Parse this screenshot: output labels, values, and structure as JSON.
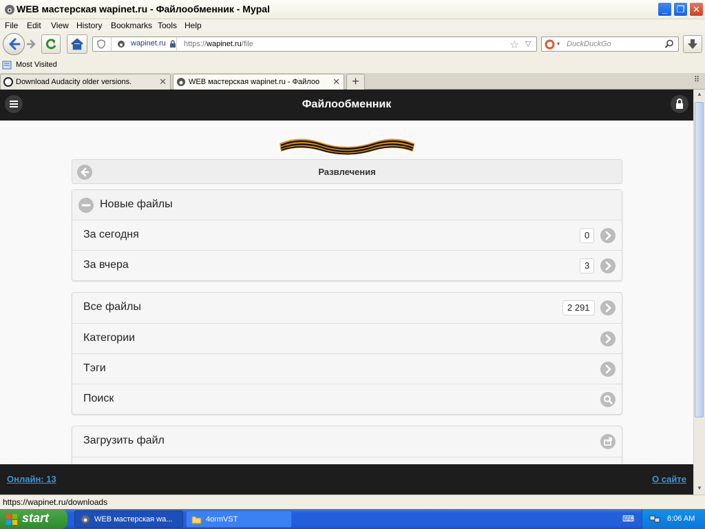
{
  "window": {
    "title": "WEB мастерская wapinet.ru - Файлообменник - Mypal"
  },
  "menu": [
    "File",
    "Edit",
    "View",
    "History",
    "Bookmarks",
    "Tools",
    "Help"
  ],
  "nav": {
    "site_identity": "wapinet.ru",
    "url_scheme": "https://",
    "url_host": "wapinet.ru",
    "url_path": "/file",
    "search_placeholder": "DuckDuckGo"
  },
  "bookmarks": {
    "most_visited": "Most Visited"
  },
  "tabs": [
    {
      "label": "Download Audacity older versions.",
      "active": false
    },
    {
      "label": "WEB мастерская wapinet.ru - Файлообм...",
      "active": true
    }
  ],
  "page": {
    "header_title": "Файлообменник",
    "breadcrumb": "Развлечения",
    "new_files": {
      "title": "Новые файлы",
      "items": [
        {
          "label": "За сегодня",
          "count": "0"
        },
        {
          "label": "За вчера",
          "count": "3"
        }
      ]
    },
    "main_menu": [
      {
        "label": "Все файлы",
        "count": "2 291",
        "icon": "arrow-right-icon"
      },
      {
        "label": "Категории",
        "count": "",
        "icon": "arrow-right-icon"
      },
      {
        "label": "Тэги",
        "count": "",
        "icon": "arrow-right-icon"
      },
      {
        "label": "Поиск",
        "count": "",
        "icon": "search-icon"
      }
    ],
    "upload": {
      "label": "Загрузить файл",
      "icon": "share-icon"
    },
    "footer": {
      "online": "Онлайн: 13",
      "about": "О сайте"
    }
  },
  "status": {
    "text": "https://wapinet.ru/downloads"
  },
  "taskbar": {
    "start": "start",
    "items": [
      "WEB мастерская wa...",
      "4ormVST"
    ],
    "clock": "6:06 AM"
  }
}
